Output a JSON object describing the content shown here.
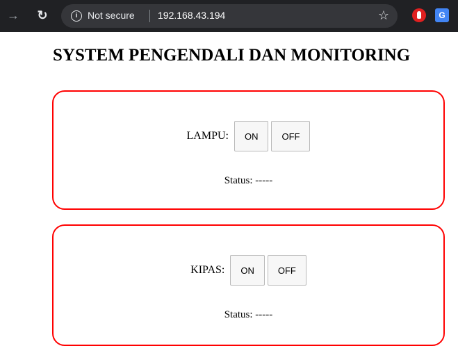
{
  "browser": {
    "security_label": "Not secure",
    "url": "192.168.43.194",
    "info_glyph": "i",
    "translate_glyph": "G",
    "icons": [
      "forward-icon",
      "reload-icon",
      "info-icon",
      "bookmark-star-icon",
      "red-hand-extension-icon",
      "translate-extension-icon"
    ]
  },
  "page": {
    "title": "SYSTEM PENGENDALI DAN MONITORING"
  },
  "devices": [
    {
      "label": "LAMPU:",
      "on_label": "ON",
      "off_label": "OFF",
      "status_text": "Status: -----"
    },
    {
      "label": "KIPAS:",
      "on_label": "ON",
      "off_label": "OFF",
      "status_text": "Status: -----"
    }
  ],
  "colors": {
    "panel_border": "#ff0000",
    "toolbar_bg": "#202124",
    "omnibox_bg": "#35363a"
  }
}
